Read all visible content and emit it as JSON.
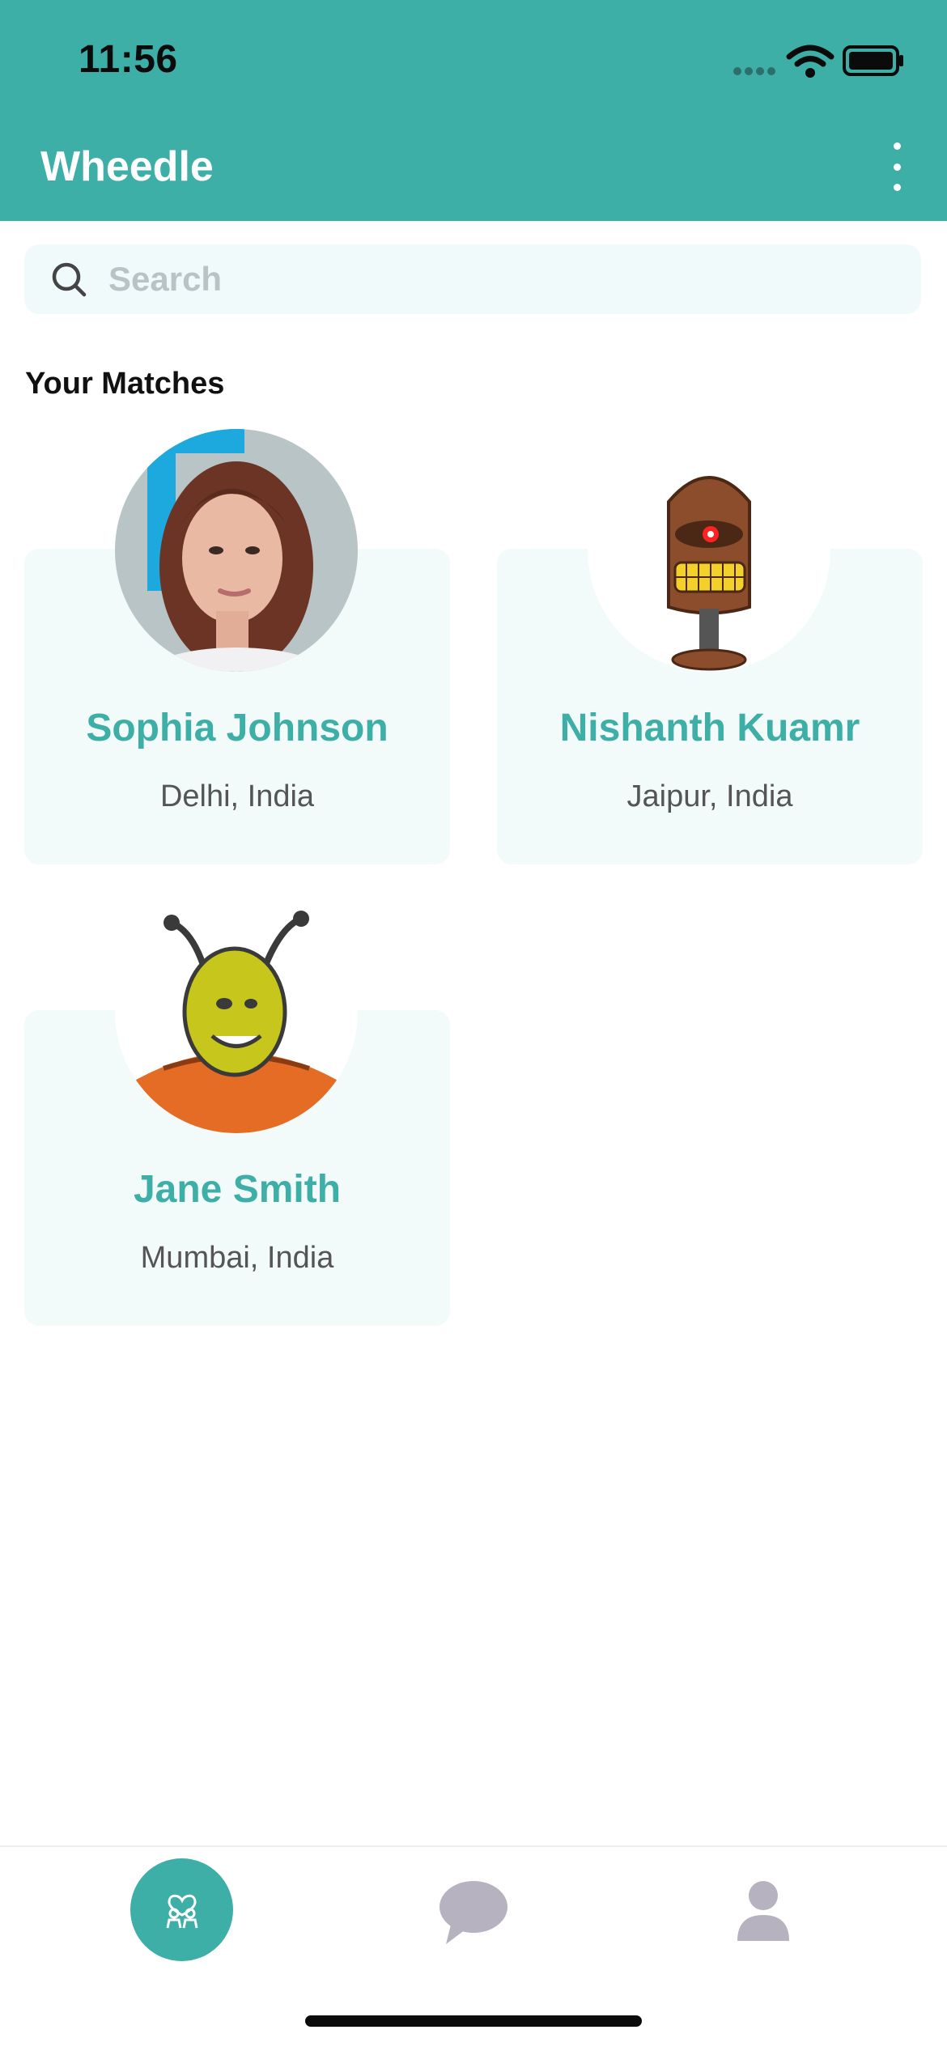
{
  "status_bar": {
    "time": "11:56"
  },
  "app_bar": {
    "title": "Wheedle"
  },
  "search": {
    "placeholder": "Search"
  },
  "matches": {
    "section_title": "Your Matches",
    "items": [
      {
        "name": "Sophia Johnson",
        "location": "Delhi, India"
      },
      {
        "name": "Nishanth Kuamr",
        "location": "Jaipur, India"
      },
      {
        "name": "Jane Smith",
        "location": "Mumbai, India"
      }
    ]
  },
  "colors": {
    "brand": "#3DAFA6",
    "card_bg": "#F3FAFA",
    "nav_inactive": "#B7B2BF"
  },
  "bottom_nav": {
    "items": [
      {
        "icon": "matches-icon",
        "active": true
      },
      {
        "icon": "chat-icon",
        "active": false
      },
      {
        "icon": "profile-icon",
        "active": false
      }
    ]
  }
}
